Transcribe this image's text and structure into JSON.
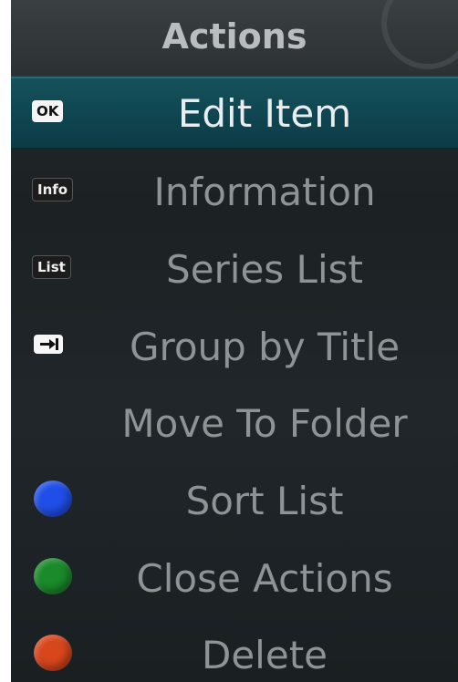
{
  "menu": {
    "title": "Actions",
    "items": [
      {
        "label": "Edit Item",
        "key": "OK",
        "selected": true
      },
      {
        "label": "Information",
        "key": "Info"
      },
      {
        "label": "Series List",
        "key": "List"
      },
      {
        "label": "Group by Title",
        "key_icon": "tab-arrow-icon"
      },
      {
        "label": "Move To Folder"
      },
      {
        "label": "Sort List",
        "key_color": "#1f4fe8"
      },
      {
        "label": "Close Actions",
        "key_color": "#1a8a2a"
      },
      {
        "label": "Delete",
        "key_color": "#d8461c"
      }
    ]
  },
  "colors": {
    "selected_row": "#0f4651",
    "item_text": "#8e9396",
    "selected_text": "#e8eef0",
    "title_text": "#b9bdbf"
  }
}
